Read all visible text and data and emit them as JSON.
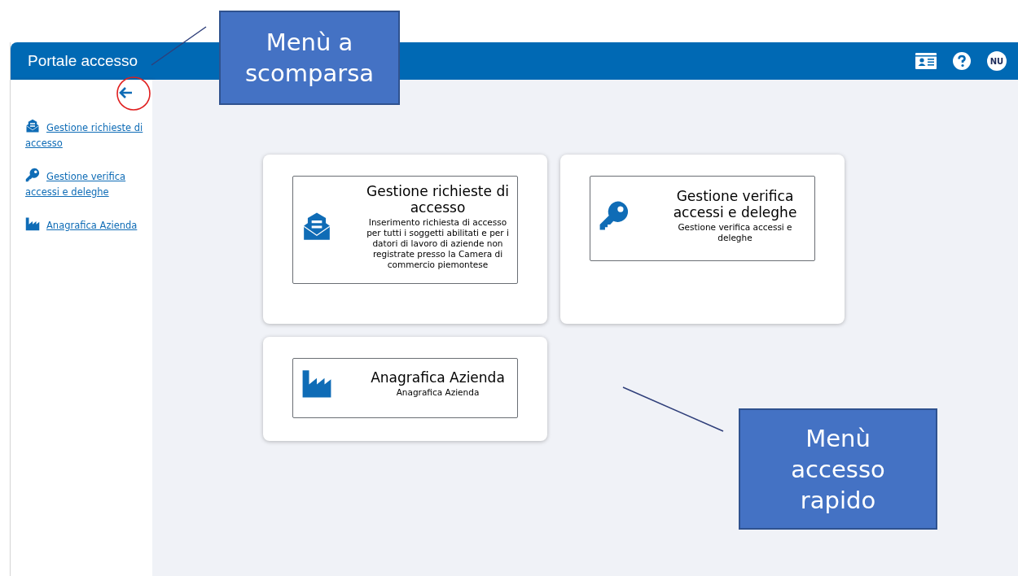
{
  "header": {
    "title": "Portale accesso",
    "avatar": "NU"
  },
  "sidebar": {
    "items": [
      {
        "label": "Gestione richieste di accesso"
      },
      {
        "label": "Gestione verifica accessi e deleghe"
      },
      {
        "label": "Anagrafica Azienda"
      }
    ]
  },
  "tiles": [
    {
      "title": "Gestione richieste di accesso",
      "description": "Inserimento richiesta di accesso per tutti i soggetti abilitati e per i datori di lavoro di aziende non registrate presso la Camera di commercio piemontese"
    },
    {
      "title": "Gestione verifica accessi e deleghe",
      "description": "Gestione verifica accessi e deleghe"
    },
    {
      "title": "Anagrafica Azienda",
      "description": "Anagrafica Azienda"
    }
  ],
  "callouts": [
    {
      "text": "Menù a scomparsa"
    },
    {
      "text": "Menù accesso rapido"
    }
  ]
}
